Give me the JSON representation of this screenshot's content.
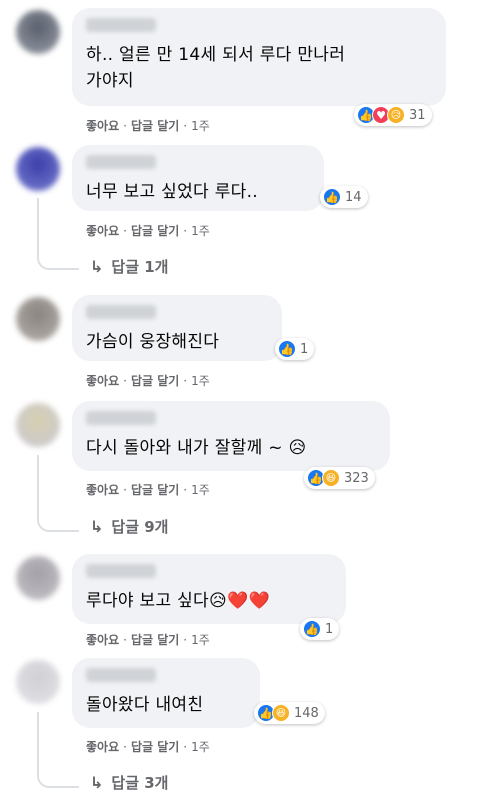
{
  "actions": {
    "like": "좋아요",
    "reply": "답글 달기",
    "time": "1주",
    "sep": "·"
  },
  "comments": [
    {
      "text": "하.. 얼른 만 14세 되서 루다 만나러\n가야지",
      "reactions": [
        "like-icon",
        "love-icon",
        "sad-icon"
      ],
      "count": "31",
      "replies": ""
    },
    {
      "text": "너무 보고 싶었다 루다..",
      "reactions": [
        "like-icon"
      ],
      "count": "14",
      "replies": "답글 1개"
    },
    {
      "text": "가슴이 웅장해진다",
      "reactions": [
        "like-icon"
      ],
      "count": "1",
      "replies": ""
    },
    {
      "text": "다시 돌아와 내가 잘할께 ~",
      "emoji": "😥",
      "reactions": [
        "like-icon",
        "haha-icon"
      ],
      "count": "323",
      "replies": "답글 9개"
    },
    {
      "text": "루다야 보고 싶다",
      "emoji": "😥❤️❤️",
      "reactions": [
        "like-icon"
      ],
      "count": "1",
      "replies": ""
    },
    {
      "text": "돌아왔다 내여친",
      "reactions": [
        "like-icon",
        "haha-icon"
      ],
      "count": "148",
      "replies": "답글 3개"
    }
  ],
  "colors": {
    "like": "#1877f2",
    "bubble": "#f0f2f5",
    "meta": "#65676b"
  }
}
